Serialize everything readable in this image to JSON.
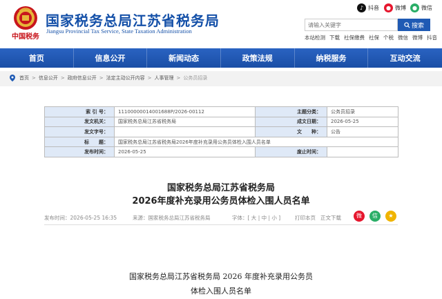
{
  "header": {
    "title": "国家税务总局江苏省税务局",
    "subtitle": "Jiangsu Provincial Tax Service, State Taxation Administration",
    "emblem_text": "中国税务",
    "social": [
      {
        "label": "抖音",
        "icon": "douyin-icon",
        "color": "#111111"
      },
      {
        "label": "微博",
        "icon": "weibo-icon",
        "color": "#e6162d"
      },
      {
        "label": "微信",
        "icon": "wechat-icon",
        "color": "#2aae67"
      }
    ],
    "search": {
      "placeholder": "请输入关键字",
      "button_label": "搜索"
    },
    "quick_links": [
      "本站检测",
      "下载",
      "社保缴费",
      "社保",
      "个税",
      "微信",
      "微博",
      "抖音"
    ]
  },
  "nav": {
    "items": [
      "首页",
      "信息公开",
      "新闻动态",
      "政策法规",
      "纳税服务",
      "互动交流"
    ],
    "color": "#1f5ab4"
  },
  "breadcrumb": [
    "首页",
    "信息公开",
    "政府信息公开",
    "法定主动公开内容",
    "人事管理",
    "公务员招录"
  ],
  "info_table": {
    "index_label": "索 引 号：",
    "index_value": "11100000014001688P/2026-00112",
    "category_label": "主题分类：",
    "category_value": "公务员招录",
    "issuer_label": "发文机关：",
    "issuer_value": "国家税务总局江苏省税务局",
    "date_label": "成文日期：",
    "date_value": "2026-05-25",
    "docno_label": "发文字号：",
    "docno_value": "",
    "type_label": "文　　种：",
    "type_value": "公告",
    "title_label": "标　　题：",
    "title_value": "国家税务总局江苏省税务局2026年度补充录用公务员体检入围人员名单",
    "pubdate_label": "发布时间：",
    "pubdate_value": "2026-05-25",
    "invalid_label": "废止时间：",
    "invalid_value": ""
  },
  "article": {
    "title_line1": "国家税务总局江苏省税务局",
    "title_line2": "2026年度补充录用公务员体检入围人员名单",
    "meta_time_label": "发布时间：",
    "meta_time": "2026-05-25 16:35",
    "meta_source_label": "来源：",
    "meta_source": "国家税务总局江苏省税务局",
    "font_size_label": "字体：",
    "font_sizes": "[ 大 | 中 | 小 ]",
    "print_label": "打印本页",
    "download_label": "正文下载",
    "body_title_line1": "国家税务总局江苏省税务局 2026 年度补充录用公务员",
    "body_title_line2": "体检入围人员名单"
  }
}
